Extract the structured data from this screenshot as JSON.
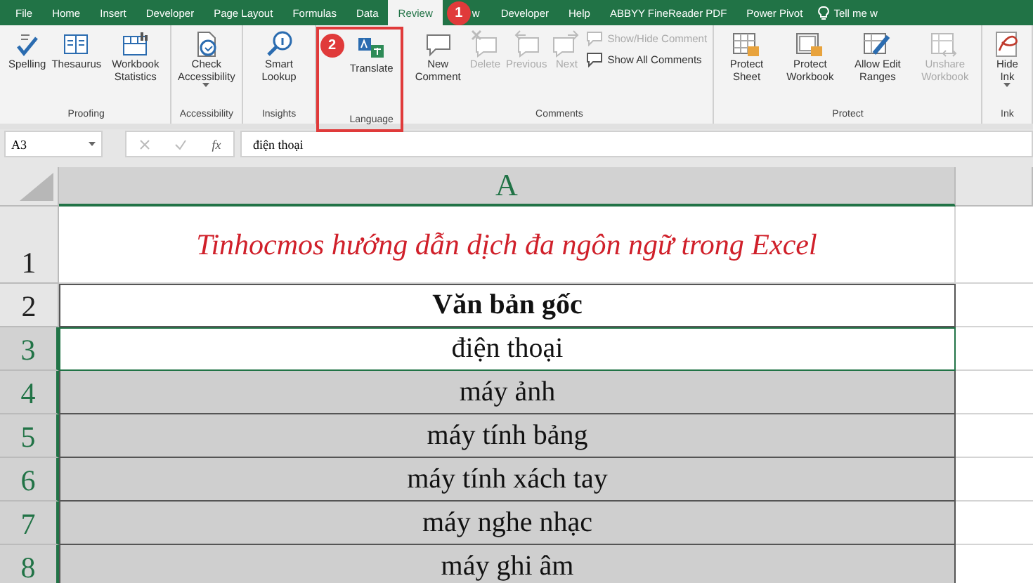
{
  "tabs": [
    {
      "label": "File",
      "selected": false
    },
    {
      "label": "Home",
      "selected": false
    },
    {
      "label": "Insert",
      "selected": false
    },
    {
      "label": "Developer",
      "selected": false
    },
    {
      "label": "Page Layout",
      "selected": false
    },
    {
      "label": "Formulas",
      "selected": false
    },
    {
      "label": "Data",
      "selected": false
    },
    {
      "label": "Review",
      "selected": true
    },
    {
      "label": "w",
      "selected": false
    },
    {
      "label": "Developer",
      "selected": false
    },
    {
      "label": "Help",
      "selected": false
    },
    {
      "label": "ABBYY FineReader PDF",
      "selected": false
    },
    {
      "label": "Power Pivot",
      "selected": false
    }
  ],
  "tell_me": "Tell me w",
  "groups": [
    {
      "label": "Proofing",
      "highlighted": false,
      "buttons": [
        {
          "kind": "large",
          "label": "Spelling",
          "disabled": false
        },
        {
          "kind": "large",
          "label": "Thesaurus",
          "disabled": false
        },
        {
          "kind": "large",
          "label": "Workbook Statistics",
          "disabled": false
        }
      ]
    },
    {
      "label": "Accessibility",
      "highlighted": false,
      "buttons": [
        {
          "kind": "large",
          "label": "Check Accessibility",
          "disabled": false,
          "dropdown": true
        }
      ]
    },
    {
      "label": "Insights",
      "highlighted": false,
      "buttons": [
        {
          "kind": "large",
          "label": "Smart Lookup",
          "disabled": false
        }
      ]
    },
    {
      "label": "Language",
      "highlighted": true,
      "buttons": [
        {
          "kind": "large",
          "label": "Translate",
          "disabled": false
        }
      ]
    },
    {
      "label": "Comments",
      "highlighted": false,
      "buttons": [
        {
          "kind": "large",
          "label": "New Comment",
          "disabled": false
        },
        {
          "kind": "large",
          "label": "Delete",
          "disabled": true
        },
        {
          "kind": "large",
          "label": "Previous",
          "disabled": true
        },
        {
          "kind": "large",
          "label": "Next",
          "disabled": true
        },
        {
          "kind": "small",
          "label": "Show/Hide Comment",
          "disabled": true
        },
        {
          "kind": "small",
          "label": "Show All Comments",
          "disabled": false
        }
      ]
    },
    {
      "label": "Protect",
      "highlighted": false,
      "buttons": [
        {
          "kind": "large",
          "label": "Protect Sheet",
          "disabled": false
        },
        {
          "kind": "large",
          "label": "Protect Workbook",
          "disabled": false
        },
        {
          "kind": "large",
          "label": "Allow Edit Ranges",
          "disabled": false
        },
        {
          "kind": "large",
          "label": "Unshare Workbook",
          "disabled": true
        }
      ]
    },
    {
      "label": "Ink",
      "highlighted": false,
      "buttons": [
        {
          "kind": "large",
          "label": "Hide Ink",
          "disabled": false,
          "dropdown": true
        }
      ]
    }
  ],
  "formula_bar": {
    "name_box": "A3",
    "function_label": "fx",
    "value": "điện thoại"
  },
  "sheet": {
    "columns": [
      {
        "label": "A",
        "selected": true
      }
    ],
    "rows": [
      {
        "number": "1",
        "kind": "title",
        "value": "Tinhocmos hướng dẫn dịch đa ngôn ngữ trong Excel",
        "selected": false,
        "active": false
      },
      {
        "number": "2",
        "kind": "header",
        "value": "Văn bản gốc",
        "selected": false,
        "active": false
      },
      {
        "number": "3",
        "kind": "data",
        "value": "điện thoại",
        "selected": true,
        "active": true
      },
      {
        "number": "4",
        "kind": "data",
        "value": "máy ảnh",
        "selected": true,
        "active": false
      },
      {
        "number": "5",
        "kind": "data",
        "value": "máy tính bảng",
        "selected": true,
        "active": false
      },
      {
        "number": "6",
        "kind": "data",
        "value": "máy tính xách tay",
        "selected": true,
        "active": false
      },
      {
        "number": "7",
        "kind": "data",
        "value": "máy nghe nhạc",
        "selected": true,
        "active": false
      },
      {
        "number": "8",
        "kind": "data",
        "value": "máy ghi âm",
        "selected": true,
        "active": false
      }
    ]
  },
  "annotations": [
    {
      "label": "1",
      "kind": "tab"
    },
    {
      "label": "2",
      "kind": "group"
    }
  ]
}
